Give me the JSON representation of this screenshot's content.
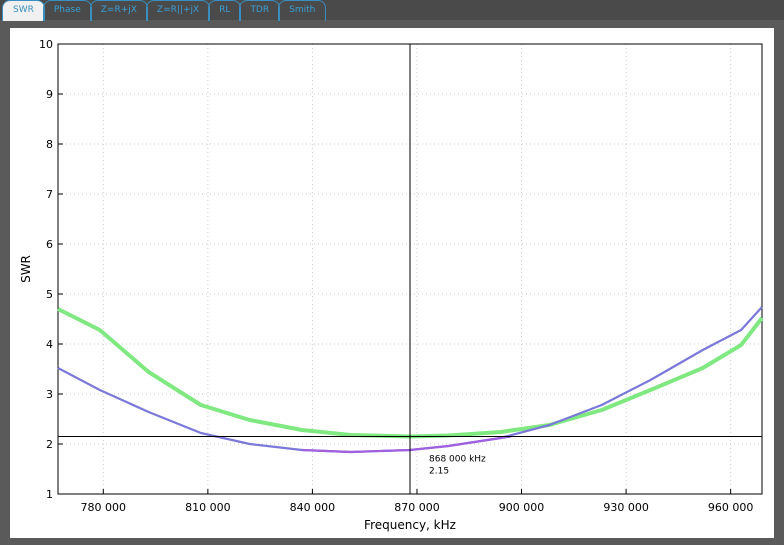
{
  "tabs": [
    {
      "label": "SWR",
      "active": true
    },
    {
      "label": "Phase"
    },
    {
      "label": "Z=R+jX"
    },
    {
      "label": "Z=R||+jX"
    },
    {
      "label": "RL"
    },
    {
      "label": "TDR"
    },
    {
      "label": "Smith"
    }
  ],
  "chart_data": {
    "type": "line",
    "xlabel": "Frequency, kHz",
    "ylabel": "SWR",
    "xlim": [
      767000,
      969000
    ],
    "ylim": [
      1,
      10
    ],
    "xticks": [
      "780 000",
      "810 000",
      "840 000",
      "870 000",
      "900 000",
      "930 000",
      "960 000"
    ],
    "xtick_values": [
      780000,
      810000,
      840000,
      870000,
      900000,
      930000,
      960000
    ],
    "yticks": [
      "1",
      "2",
      "3",
      "4",
      "5",
      "6",
      "7",
      "8",
      "9",
      "10"
    ],
    "grid": true,
    "series": [
      {
        "color": "#80e880",
        "x": [
          767000,
          779000,
          793000,
          808000,
          822000,
          837000,
          851000,
          868000,
          879000,
          894000,
          908000,
          923000,
          937000,
          952000,
          963000,
          969000
        ],
        "y": [
          4.7,
          4.28,
          3.44,
          2.78,
          2.48,
          2.28,
          2.18,
          2.15,
          2.17,
          2.24,
          2.38,
          2.68,
          3.08,
          3.52,
          3.98,
          4.52
        ]
      },
      {
        "color": "#7a78d8",
        "x": [
          767000,
          779000,
          793000,
          808000,
          822000,
          837000,
          851000,
          868000,
          879000,
          894000,
          908000,
          923000,
          937000,
          952000,
          963000,
          969000
        ],
        "y": [
          3.52,
          3.08,
          2.64,
          2.22,
          2.0,
          1.88,
          1.84,
          1.88,
          1.96,
          2.12,
          2.38,
          2.78,
          3.28,
          3.88,
          4.28,
          4.74
        ]
      },
      {
        "color": "#a060e0",
        "x": [
          837000,
          851000,
          868000,
          879000,
          894000,
          897000
        ],
        "y": [
          1.88,
          1.84,
          1.88,
          1.96,
          2.12,
          2.15
        ]
      }
    ],
    "cursor": {
      "frequency": "868 000 kHz",
      "swr": "2.15",
      "x": 868000,
      "y": 2.15
    }
  }
}
